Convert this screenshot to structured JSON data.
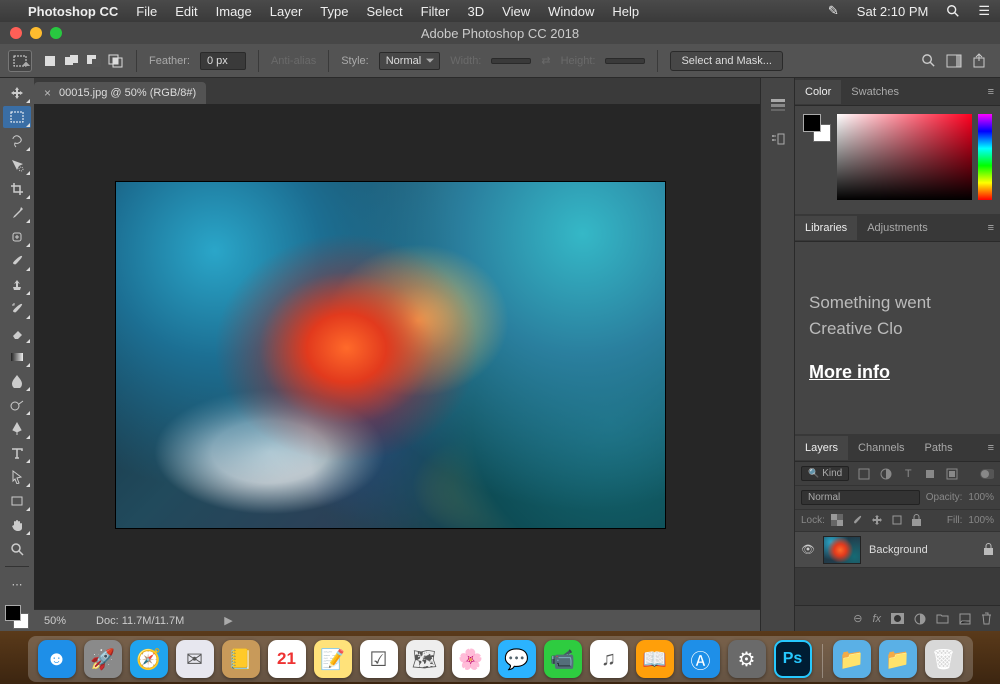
{
  "mac_menu": {
    "app": "Photoshop CC",
    "items": [
      "File",
      "Edit",
      "Image",
      "Layer",
      "Type",
      "Select",
      "Filter",
      "3D",
      "View",
      "Window",
      "Help"
    ],
    "clock": "Sat 2:10 PM"
  },
  "window_title": "Adobe Photoshop CC 2018",
  "options_bar": {
    "feather_label": "Feather:",
    "feather_value": "0 px",
    "antialias": "Anti-alias",
    "style_label": "Style:",
    "style_value": "Normal",
    "width_label": "Width:",
    "height_label": "Height:",
    "select_mask": "Select and Mask..."
  },
  "doc_tab": {
    "title": "00015.jpg @ 50% (RGB/8#)"
  },
  "status": {
    "zoom": "50%",
    "doc": "Doc: 11.7M/11.7M"
  },
  "panel_tabs": {
    "color": "Color",
    "swatches": "Swatches",
    "libraries": "Libraries",
    "adjustments": "Adjustments",
    "layers": "Layers",
    "channels": "Channels",
    "paths": "Paths"
  },
  "libraries_body": {
    "line1": "Something went",
    "line2": "Creative Clo",
    "link": "More info"
  },
  "layers": {
    "kind_placeholder": "Kind",
    "blend_mode": "Normal",
    "opacity_label": "Opacity:",
    "opacity_value": "100%",
    "lock_label": "Lock:",
    "fill_label": "Fill:",
    "fill_value": "100%",
    "rows": [
      {
        "name": "Background"
      }
    ]
  },
  "dock": [
    {
      "name": "finder",
      "bg": "#1e8fe8",
      "glyph": "☻"
    },
    {
      "name": "launchpad",
      "bg": "#8a8a8a",
      "glyph": "🚀"
    },
    {
      "name": "safari",
      "bg": "#1fa4ef",
      "glyph": "🧭"
    },
    {
      "name": "mail",
      "bg": "#e7e7ef",
      "glyph": "✉︎"
    },
    {
      "name": "contacts",
      "bg": "#c89a5a",
      "glyph": "📒"
    },
    {
      "name": "calendar",
      "bg": "#ffffff",
      "glyph": "21"
    },
    {
      "name": "notes",
      "bg": "#ffe27a",
      "glyph": "📝"
    },
    {
      "name": "reminders",
      "bg": "#ffffff",
      "glyph": "☑︎"
    },
    {
      "name": "maps",
      "bg": "#eeeeee",
      "glyph": "🗺"
    },
    {
      "name": "photos",
      "bg": "#ffffff",
      "glyph": "🌸"
    },
    {
      "name": "messages",
      "bg": "#2bb3ff",
      "glyph": "💬"
    },
    {
      "name": "facetime",
      "bg": "#2ecc40",
      "glyph": "📹"
    },
    {
      "name": "itunes",
      "bg": "#ffffff",
      "glyph": "♫"
    },
    {
      "name": "ibooks",
      "bg": "#ff9f0a",
      "glyph": "📖"
    },
    {
      "name": "appstore",
      "bg": "#1e8fe8",
      "glyph": "Ⓐ"
    },
    {
      "name": "preferences",
      "bg": "#6a6a6a",
      "glyph": "⚙︎"
    },
    {
      "name": "photoshop",
      "bg": "#001d33",
      "glyph": "Ps"
    },
    {
      "name": "sep",
      "bg": "",
      "glyph": ""
    },
    {
      "name": "documents",
      "bg": "#5ab0e6",
      "glyph": "📁"
    },
    {
      "name": "downloads",
      "bg": "#5ab0e6",
      "glyph": "📁"
    },
    {
      "name": "trash",
      "bg": "#d8d8d8",
      "glyph": "🗑"
    }
  ]
}
